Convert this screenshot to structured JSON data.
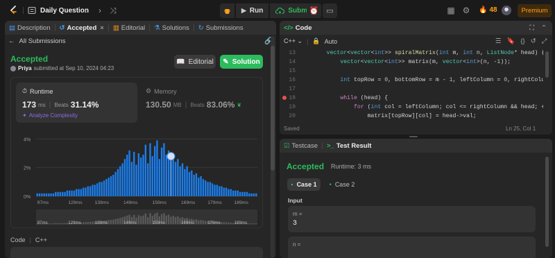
{
  "topbar": {
    "title": "Daily Question",
    "run_label": "Run",
    "submit_label": "Submit",
    "streak_count": "48",
    "premium_label": "Premium"
  },
  "left_panel": {
    "tabs": [
      {
        "label": "Description"
      },
      {
        "label": "Accepted"
      },
      {
        "label": "Editorial"
      },
      {
        "label": "Solutions"
      },
      {
        "label": "Submissions"
      }
    ],
    "back_label": "All Submissions",
    "status": "Accepted",
    "user": "Priya",
    "submitted_text": "submitted at Sep 10, 2024 04:23",
    "editorial_button": "Editorial",
    "solution_button": "Solution",
    "runtime": {
      "label": "Runtime",
      "value": "173",
      "unit": "ms",
      "beats_label": "Beats",
      "beats_value": "31.14%",
      "analyze_label": "Analyze Complexity"
    },
    "memory": {
      "label": "Memory",
      "value": "130.50",
      "unit": "MB",
      "beats_label": "Beats",
      "beats_value": "83.06%"
    },
    "code_section": {
      "label": "Code",
      "language": "C++"
    }
  },
  "chart_data": {
    "type": "bar",
    "y_ticks": [
      "4%",
      "2%",
      "0%"
    ],
    "ylim": [
      0,
      4.5
    ],
    "x_ticks": [
      "97ms",
      "129ms",
      "139ms",
      "149ms",
      "159ms",
      "169ms",
      "179ms",
      "189ms"
    ],
    "values": [
      0.2,
      0.2,
      0.2,
      0.2,
      0.2,
      0.2,
      0.2,
      0.2,
      0.3,
      0.3,
      0.3,
      0.3,
      0.3,
      0.4,
      0.4,
      0.4,
      0.4,
      0.5,
      0.5,
      0.5,
      0.6,
      0.6,
      0.7,
      0.7,
      0.8,
      0.8,
      0.9,
      1.0,
      1.0,
      1.1,
      1.2,
      1.3,
      1.4,
      1.5,
      1.7,
      1.9,
      2.1,
      2.3,
      2.6,
      2.9,
      3.2,
      2.4,
      3.1,
      2.2,
      3.0,
      2.7,
      2.9,
      3.6,
      2.3,
      3.7,
      2.8,
      3.5,
      3.9,
      2.6,
      3.4,
      3.7,
      2.9,
      3.2,
      2.5,
      2.8,
      2.4,
      2.6,
      2.1,
      2.3,
      1.9,
      2.1,
      1.7,
      1.8,
      1.5,
      1.6,
      1.3,
      1.4,
      1.2,
      1.1,
      1.0,
      1.0,
      0.9,
      0.8,
      0.8,
      0.7,
      0.7,
      0.6,
      0.6,
      0.5,
      0.5,
      0.4,
      0.4,
      0.4,
      0.3,
      0.3,
      0.3,
      0.3,
      0.2,
      0.2,
      0.2,
      0.2
    ],
    "highlight_index": 58,
    "colors": {
      "bar": "#1a7ff0",
      "highlight": "#4a9cf0",
      "minimap_bar": "#5a5a5a"
    }
  },
  "editor": {
    "title": "Code",
    "language": "C++",
    "mode": "Auto",
    "line_numbers": [
      "13",
      "14",
      "15",
      "16",
      "17",
      "18",
      "19",
      "20",
      "21"
    ],
    "breakpoint_line": "19",
    "lines": [
      "    vector<vector<int>> spiralMatrix(int m, int n, ListNode* head) {",
      "        vector<vector<int>> matrix(m, vector<int>(n, -1));",
      "",
      "        int topRow = 0, bottomRow = m - 1, leftColumn = 0, rightColumn = n - 1;",
      "",
      "        while (head) {",
      "            for (int col = leftColumn; col <= rightColumn && head; ++col) {",
      "                matrix[topRow][col] = head->val;",
      "                head = head->next;"
    ],
    "status_left": "Saved",
    "status_right": "Ln 25, Col 1"
  },
  "result_panel": {
    "tabs": [
      {
        "label": "Testcase"
      },
      {
        "label": "Test Result"
      }
    ],
    "status": "Accepted",
    "runtime_text": "Runtime: 3 ms",
    "cases": [
      {
        "label": "Case 1"
      },
      {
        "label": "Case 2"
      }
    ],
    "input_label": "Input",
    "params": [
      {
        "name": "m =",
        "value": "3"
      },
      {
        "name": "n =",
        "value": ""
      }
    ]
  }
}
